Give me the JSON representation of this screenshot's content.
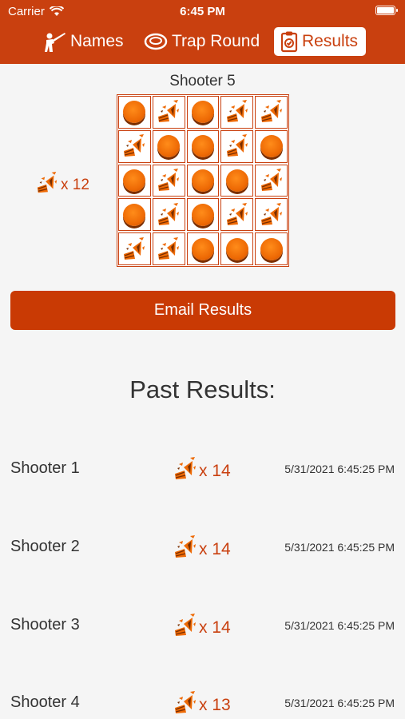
{
  "status_bar": {
    "carrier": "Carrier",
    "time": "6:45 PM"
  },
  "tabs": [
    {
      "label": "Names",
      "icon": "shooter-icon"
    },
    {
      "label": "Trap Round",
      "icon": "clay-target-icon"
    },
    {
      "label": "Results",
      "icon": "clipboard-icon",
      "selected": true
    }
  ],
  "current": {
    "shooter": "Shooter 5",
    "score_text": "x 12",
    "grid": [
      [
        "hit",
        "broken",
        "hit",
        "broken",
        "broken"
      ],
      [
        "broken",
        "hit",
        "hit",
        "broken",
        "hit"
      ],
      [
        "hit",
        "broken",
        "hit",
        "hit",
        "broken"
      ],
      [
        "hit",
        "broken",
        "hit",
        "broken",
        "broken"
      ],
      [
        "broken",
        "broken",
        "hit",
        "hit",
        "hit"
      ]
    ]
  },
  "email_button": "Email Results",
  "past_title": "Past Results:",
  "past_results": [
    {
      "name": "Shooter 1",
      "score": "x 14",
      "date": "5/31/2021 6:45:25 PM"
    },
    {
      "name": "Shooter 2",
      "score": "x 14",
      "date": "5/31/2021 6:45:25 PM"
    },
    {
      "name": "Shooter 3",
      "score": "x 14",
      "date": "5/31/2021 6:45:25 PM"
    },
    {
      "name": "Shooter 4",
      "score": "x 13",
      "date": "5/31/2021 6:45:25 PM"
    }
  ],
  "colors": {
    "accent": "#c9400f",
    "button": "#c93a04",
    "target": "#ee6a05"
  }
}
